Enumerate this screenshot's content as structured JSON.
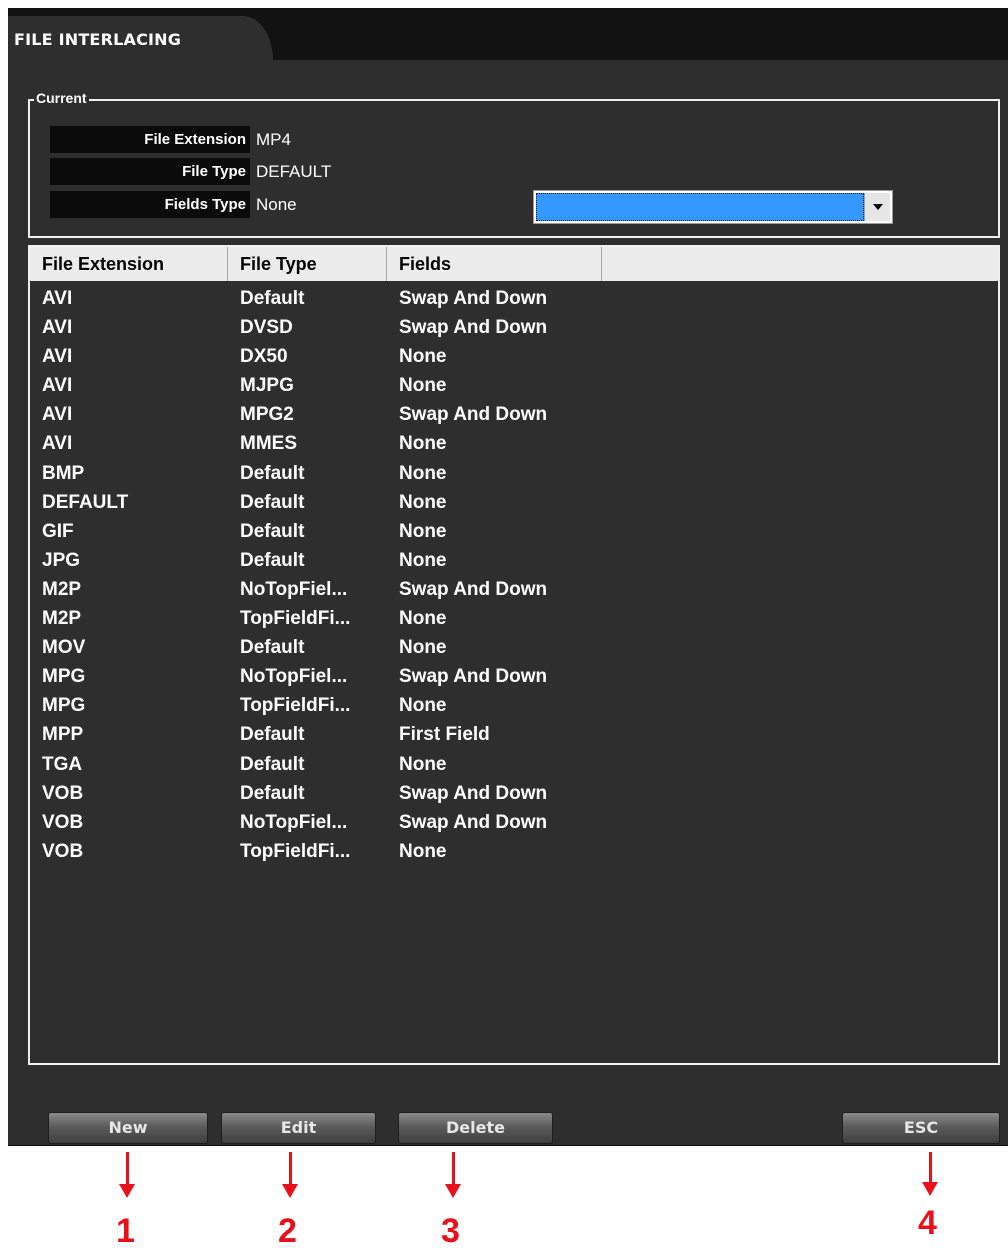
{
  "window": {
    "title": "FILE INTERLACING"
  },
  "current": {
    "legend": "Current",
    "file_extension_label": "File Extension",
    "file_extension_value": "MP4",
    "file_type_label": "File Type",
    "file_type_value": "DEFAULT",
    "fields_type_label": "Fields Type",
    "fields_type_value": "None",
    "combo_selected": ""
  },
  "list": {
    "columns": [
      "File Extension",
      "File Type",
      "Fields"
    ],
    "rows": [
      [
        "AVI",
        "Default",
        "Swap And Down"
      ],
      [
        "AVI",
        "DVSD",
        "Swap And Down"
      ],
      [
        "AVI",
        "DX50",
        "None"
      ],
      [
        "AVI",
        "MJPG",
        "None"
      ],
      [
        "AVI",
        "MPG2",
        "Swap And Down"
      ],
      [
        "AVI",
        "MMES",
        "None"
      ],
      [
        "BMP",
        "Default",
        "None"
      ],
      [
        "DEFAULT",
        "Default",
        "None"
      ],
      [
        "GIF",
        "Default",
        "None"
      ],
      [
        "JPG",
        "Default",
        "None"
      ],
      [
        "M2P",
        "NoTopFiel...",
        "Swap And Down"
      ],
      [
        "M2P",
        "TopFieldFi...",
        "None"
      ],
      [
        "MOV",
        "Default",
        "None"
      ],
      [
        "MPG",
        "NoTopFiel...",
        "Swap And Down"
      ],
      [
        "MPG",
        "TopFieldFi...",
        "None"
      ],
      [
        "MPP",
        "Default",
        "First Field"
      ],
      [
        "TGA",
        "Default",
        "None"
      ],
      [
        "VOB",
        "Default",
        "Swap And Down"
      ],
      [
        "VOB",
        "NoTopFiel...",
        "Swap And Down"
      ],
      [
        "VOB",
        "TopFieldFi...",
        "None"
      ]
    ]
  },
  "buttons": {
    "new": "New",
    "edit": "Edit",
    "delete": "Delete",
    "esc": "ESC"
  },
  "annotations": {
    "new": "1",
    "edit": "2",
    "delete": "3",
    "esc": "4",
    "color": "#e8111b"
  },
  "colors": {
    "panel": "#2e2e2e",
    "title_strip": "#121212",
    "combo_highlight": "#3399ff"
  }
}
